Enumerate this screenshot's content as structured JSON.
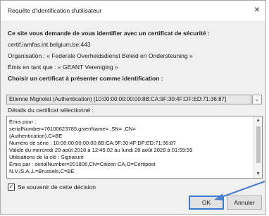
{
  "dialog": {
    "title": "Requête d'identification d'utilisateur",
    "close_glyph": "×",
    "heading": "Ce site vous demande de vous identifier avec un certificat de sécurité :",
    "host": "certif.iamfas.int.belgium.be:443",
    "organisation": "Organisation : « Federale Overheidsdienst Beleid en Ondersteuning »",
    "issued_under": "Émis en tant que : « GEANT Vereniging »",
    "choose_label": "Choisir un certificat à présenter comme identification :",
    "selected_certificate": "Etienne Mignolet (Authentication) [10:00:00:00:00:00:8B:CA:9F:30:4F:DF:ED:71:36:87]",
    "details_label": "Détails du certificat sélectionné :",
    "details_lines": [
      "Émis pour :",
      "serialNumber=76100623785,givenName=               ,SN=            ,CN=",
      "(Authentication),C=BE",
      "Numéro de série : 10:00:00:00:00:00:8B:CA:9F:30:4F:DF:ED:71:36:87",
      "Valide du mercredi 29 août 2018 à 12:45:02 au lundi 28 août 2028 à 01:59:59",
      "Utilisations de la clé : Signature",
      "Émis par : serialNumber=201806,CN=Citizen CA,O=Certipost",
      "N.V./S.A.,L=Brussels,C=BE"
    ],
    "remember_label": "Se souvenir de cette décision",
    "remember_checked": true,
    "ok_label": "OK",
    "cancel_label": "Annuler"
  },
  "icons": {
    "close": "close-icon",
    "dropdown": "chevron-down-icon",
    "annotation": "arrow-annotation"
  },
  "colors": {
    "dialog_bg": "#f0f0f0",
    "annotation_arrow": "#4a7fd0"
  }
}
